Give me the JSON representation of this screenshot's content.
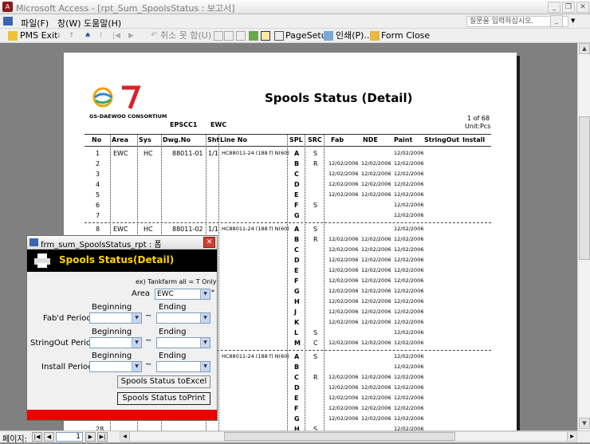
{
  "window": {
    "title": "Microsoft Access - [rpt_Sum_SpoolsStatus : 보고서]"
  },
  "menu": [
    "파일(F)",
    "창(W)",
    "도움말(H)"
  ],
  "ask_placeholder": "질문을 입력하십시오.",
  "toolbar": {
    "pms_exit": "PMS Exit",
    "cancel": "취소 못 함(U)",
    "page_setup": "PageSetup",
    "print": "인쇄(P)...",
    "form_close": "Form Close"
  },
  "report": {
    "logo_caption": "GS-DAEWOO CONSORTIUM",
    "title": "Spools Status (Detail)",
    "unit_code": "EPSCC1",
    "area_code": "EWC",
    "page_info": "1 of 68",
    "unit": "Unit:Pcs",
    "columns": [
      "No",
      "Area",
      "Sys",
      "Dwg.No",
      "Sht",
      "Line No",
      "SPL",
      "SRC",
      "Fab",
      "NDE",
      "Paint",
      "StringOut",
      "Install"
    ],
    "groups": [
      {
        "area": "EWC",
        "sys": "HC",
        "dwg": "88011-01",
        "sht": "1/1",
        "line": "HC88011-24 (188 f) N(60)",
        "rows": [
          {
            "no": "1",
            "spl": "A",
            "src": "S",
            "fab": "",
            "nde": "",
            "paint": "12/02/2006"
          },
          {
            "no": "2",
            "spl": "B",
            "src": "R",
            "fab": "12/02/2006",
            "nde": "12/02/2006",
            "paint": "12/02/2006"
          },
          {
            "no": "3",
            "spl": "C",
            "src": "",
            "fab": "12/02/2006",
            "nde": "12/02/2006",
            "paint": "12/02/2006"
          },
          {
            "no": "4",
            "spl": "D",
            "src": "",
            "fab": "12/02/2006",
            "nde": "12/02/2006",
            "paint": "12/02/2006"
          },
          {
            "no": "5",
            "spl": "E",
            "src": "",
            "fab": "12/02/2006",
            "nde": "12/02/2006",
            "paint": "12/02/2006"
          },
          {
            "no": "6",
            "spl": "F",
            "src": "S",
            "fab": "",
            "nde": "",
            "paint": "12/02/2006"
          },
          {
            "no": "7",
            "spl": "G",
            "src": "",
            "fab": "",
            "nde": "",
            "paint": "12/02/2006"
          }
        ]
      },
      {
        "area": "EWC",
        "sys": "HC",
        "dwg": "88011-02",
        "sht": "1/1",
        "line": "HC88011-24 (188 f) N(60)",
        "rows": [
          {
            "no": "8",
            "spl": "A",
            "src": "S",
            "fab": "",
            "nde": "",
            "paint": "12/02/2006"
          },
          {
            "no": "9",
            "spl": "B",
            "src": "R",
            "fab": "12/02/2006",
            "nde": "12/02/2006",
            "paint": "12/02/2006"
          },
          {
            "no": "",
            "spl": "C",
            "src": "",
            "fab": "12/02/2006",
            "nde": "12/02/2006",
            "paint": "12/02/2006"
          },
          {
            "no": "",
            "spl": "D",
            "src": "",
            "fab": "12/02/2006",
            "nde": "12/02/2006",
            "paint": "12/02/2006"
          },
          {
            "no": "",
            "spl": "E",
            "src": "",
            "fab": "12/02/2006",
            "nde": "12/02/2006",
            "paint": "12/02/2006"
          },
          {
            "no": "",
            "spl": "F",
            "src": "",
            "fab": "12/02/2006",
            "nde": "12/02/2006",
            "paint": "12/02/2006"
          },
          {
            "no": "",
            "spl": "G",
            "src": "",
            "fab": "12/02/2006",
            "nde": "12/02/2006",
            "paint": "12/02/2006"
          },
          {
            "no": "",
            "spl": "H",
            "src": "",
            "fab": "12/02/2006",
            "nde": "12/02/2006",
            "paint": "12/02/2006"
          },
          {
            "no": "",
            "spl": "J",
            "src": "",
            "fab": "12/02/2006",
            "nde": "12/02/2006",
            "paint": "12/02/2006"
          },
          {
            "no": "",
            "spl": "K",
            "src": "",
            "fab": "12/02/2006",
            "nde": "12/02/2006",
            "paint": "12/02/2006"
          },
          {
            "no": "",
            "spl": "L",
            "src": "S",
            "fab": "",
            "nde": "",
            "paint": "12/02/2006"
          },
          {
            "no": "",
            "spl": "M",
            "src": "C",
            "fab": "12/02/2006",
            "nde": "12/02/2006",
            "paint": "12/02/2006"
          }
        ]
      },
      {
        "area": "",
        "sys": "",
        "dwg": "",
        "sht": "",
        "line": "HC88011-24 (188 f) N(60)",
        "rows": [
          {
            "no": "",
            "spl": "A",
            "src": "S",
            "fab": "",
            "nde": "",
            "paint": "12/02/2006"
          },
          {
            "no": "",
            "spl": "B",
            "src": "",
            "fab": "",
            "nde": "",
            "paint": "12/02/2006"
          },
          {
            "no": "",
            "spl": "C",
            "src": "R",
            "fab": "12/02/2006",
            "nde": "12/02/2006",
            "paint": "12/02/2006"
          },
          {
            "no": "",
            "spl": "D",
            "src": "",
            "fab": "12/02/2006",
            "nde": "12/02/2006",
            "paint": "12/02/2006"
          },
          {
            "no": "",
            "spl": "E",
            "src": "",
            "fab": "12/02/2006",
            "nde": "12/02/2006",
            "paint": "12/02/2006"
          },
          {
            "no": "",
            "spl": "F",
            "src": "",
            "fab": "12/02/2006",
            "nde": "12/02/2006",
            "paint": "12/02/2006"
          },
          {
            "no": "",
            "spl": "G",
            "src": "",
            "fab": "12/02/2006",
            "nde": "12/02/2006",
            "paint": "12/02/2006"
          },
          {
            "no": "28",
            "spl": "H",
            "src": "S",
            "fab": "",
            "nde": "",
            "paint": "12/02/2006"
          },
          {
            "no": "",
            "spl": "J",
            "src": "",
            "fab": "",
            "nde": "",
            "paint": "12/02/2006"
          }
        ]
      }
    ]
  },
  "status": {
    "page_label": "페이지:",
    "page_value": "1"
  },
  "dialog": {
    "title": "frm_sum_SpoolsStatus_rpt : 폼",
    "header": "Spools Status(Detail)",
    "hint": "ex) Tankfarm all = T Only",
    "area_label": "Area",
    "area_value": "EWC",
    "beginning": "Beginning",
    "ending": "Ending",
    "tilde": "~",
    "periods": [
      "Fab'd Period",
      "StringOut Period",
      "Install Period"
    ],
    "btn_excel": "Spools Status toExcel",
    "btn_print": "Spools Status toPrint"
  },
  "colors": {
    "dialog_header_bg": "#000000",
    "dialog_header_text": "#ffd400",
    "dialog_footer": "#ee0000"
  }
}
